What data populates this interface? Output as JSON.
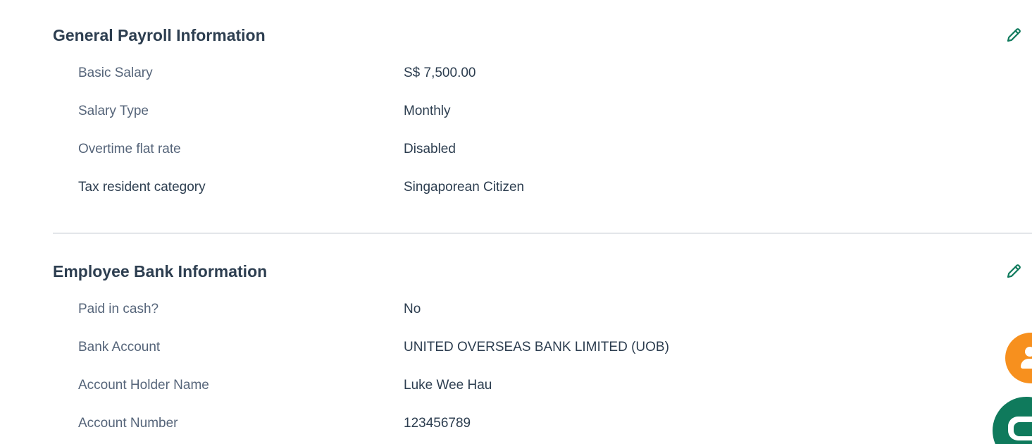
{
  "general": {
    "title": "General Payroll Information",
    "rows": [
      {
        "label": "Basic Salary",
        "value": "S$ 7,500.00"
      },
      {
        "label": "Salary Type",
        "value": "Monthly"
      },
      {
        "label": "Overtime flat rate",
        "value": "Disabled"
      },
      {
        "label": "Tax resident category",
        "value": "Singaporean Citizen"
      }
    ]
  },
  "bank": {
    "title": "Employee Bank Information",
    "rows": [
      {
        "label": "Paid in cash?",
        "value": "No"
      },
      {
        "label": "Bank Account",
        "value": "UNITED OVERSEAS BANK LIMITED (UOB)"
      },
      {
        "label": "Account Holder Name",
        "value": "Luke Wee Hau"
      },
      {
        "label": "Account Number",
        "value": "123456789"
      }
    ]
  },
  "icons": {
    "edit": "pencil-icon",
    "support": "person-icon",
    "chat": "chat-bubble-icon"
  },
  "colors": {
    "accent": "#0f7a5c",
    "support_fab": "#f7901e",
    "heading": "#2d3e50",
    "label": "#56657a",
    "divider": "#e3e6ea"
  }
}
